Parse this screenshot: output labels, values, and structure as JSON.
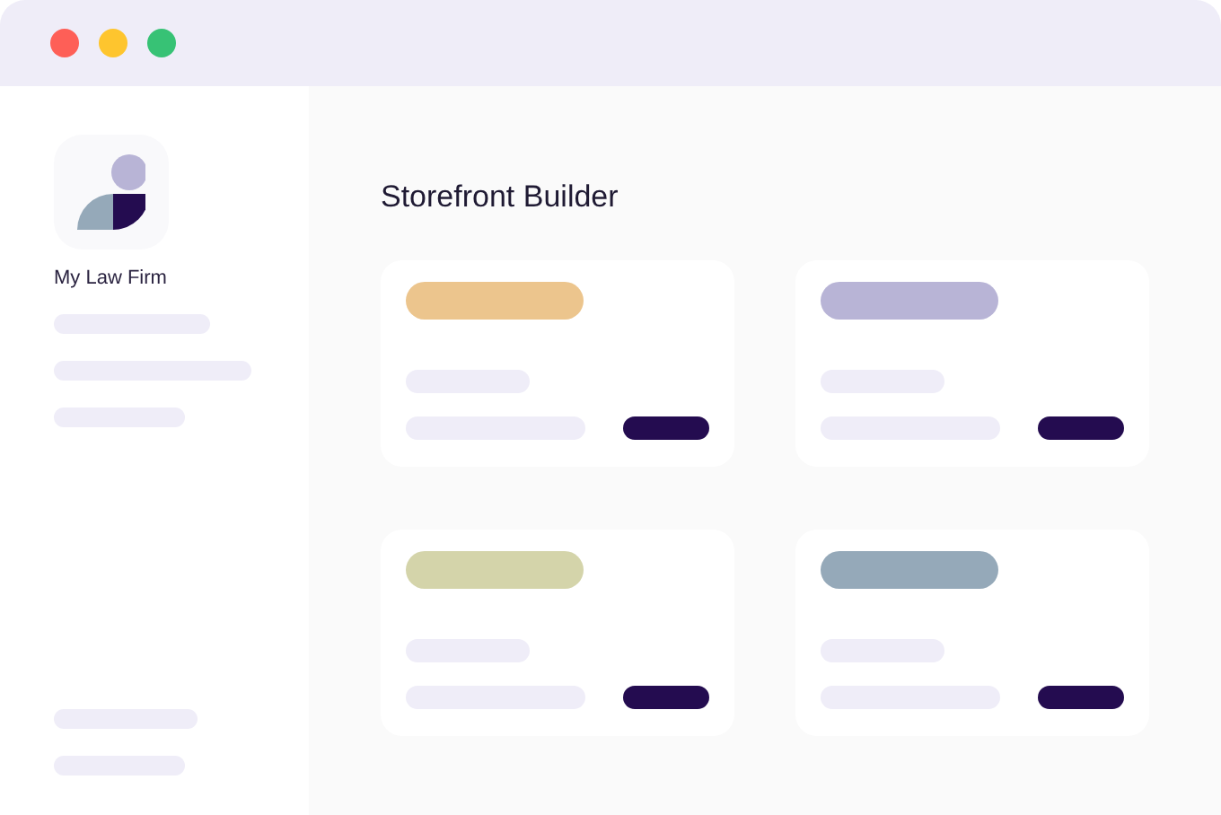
{
  "sidebar": {
    "app_name": "My Law Firm"
  },
  "main": {
    "title": "Storefront Builder"
  },
  "cards": [
    {
      "color": "#ecc58d"
    },
    {
      "color": "#b8b4d6"
    },
    {
      "color": "#d4d4aa"
    },
    {
      "color": "#95a9b9"
    }
  ]
}
